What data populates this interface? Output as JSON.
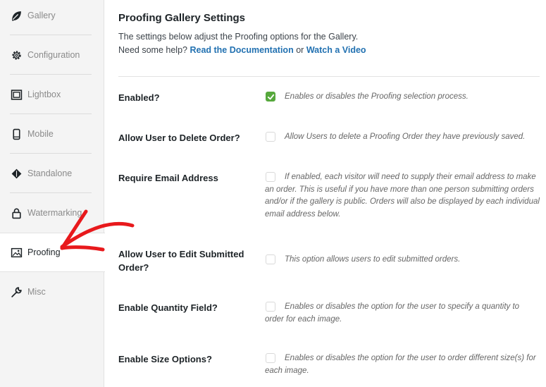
{
  "sidebar": {
    "items": [
      {
        "label": "Gallery",
        "icon": "leaf-icon",
        "active": false
      },
      {
        "label": "Configuration",
        "icon": "gear-icon",
        "active": false
      },
      {
        "label": "Lightbox",
        "icon": "lightbox-icon",
        "active": false
      },
      {
        "label": "Mobile",
        "icon": "mobile-icon",
        "active": false
      },
      {
        "label": "Standalone",
        "icon": "diamond-icon",
        "active": false
      },
      {
        "label": "Watermarking",
        "icon": "lock-icon",
        "active": false
      },
      {
        "label": "Proofing",
        "icon": "proofing-image-icon",
        "active": true
      },
      {
        "label": "Misc",
        "icon": "wrench-icon",
        "active": false
      }
    ]
  },
  "main": {
    "title": "Proofing Gallery Settings",
    "desc_line1": "The settings below adjust the Proofing options for the Gallery.",
    "desc_help": "Need some help?",
    "doc_link": "Read the Documentation",
    "or_text": "or",
    "video_link": "Watch a Video"
  },
  "settings": [
    {
      "label": "Enabled?",
      "checked": true,
      "desc": "Enables or disables the Proofing selection process."
    },
    {
      "label": "Allow User to Delete Order?",
      "checked": false,
      "desc": "Allow Users to delete a Proofing Order they have previously saved."
    },
    {
      "label": "Require Email Address",
      "checked": false,
      "desc": "If enabled, each visitor will need to supply their email address to make an order. This is useful if you have more than one person submitting orders and/or if the gallery is public. Orders will also be displayed by each individual email address below."
    },
    {
      "label": "Allow User to Edit Submitted Order?",
      "checked": false,
      "desc": "This option allows users to edit submitted orders."
    },
    {
      "label": "Enable Quantity Field?",
      "checked": false,
      "desc": "Enables or disables the option for the user to specify a quantity to order for each image."
    },
    {
      "label": "Enable Size Options?",
      "checked": false,
      "desc": "Enables or disables the option for the user to order different size(s) for each image."
    }
  ],
  "colors": {
    "accent_link": "#2271b1",
    "checkbox_checked": "#56a83c",
    "annotation_arrow": "#e8191c"
  }
}
